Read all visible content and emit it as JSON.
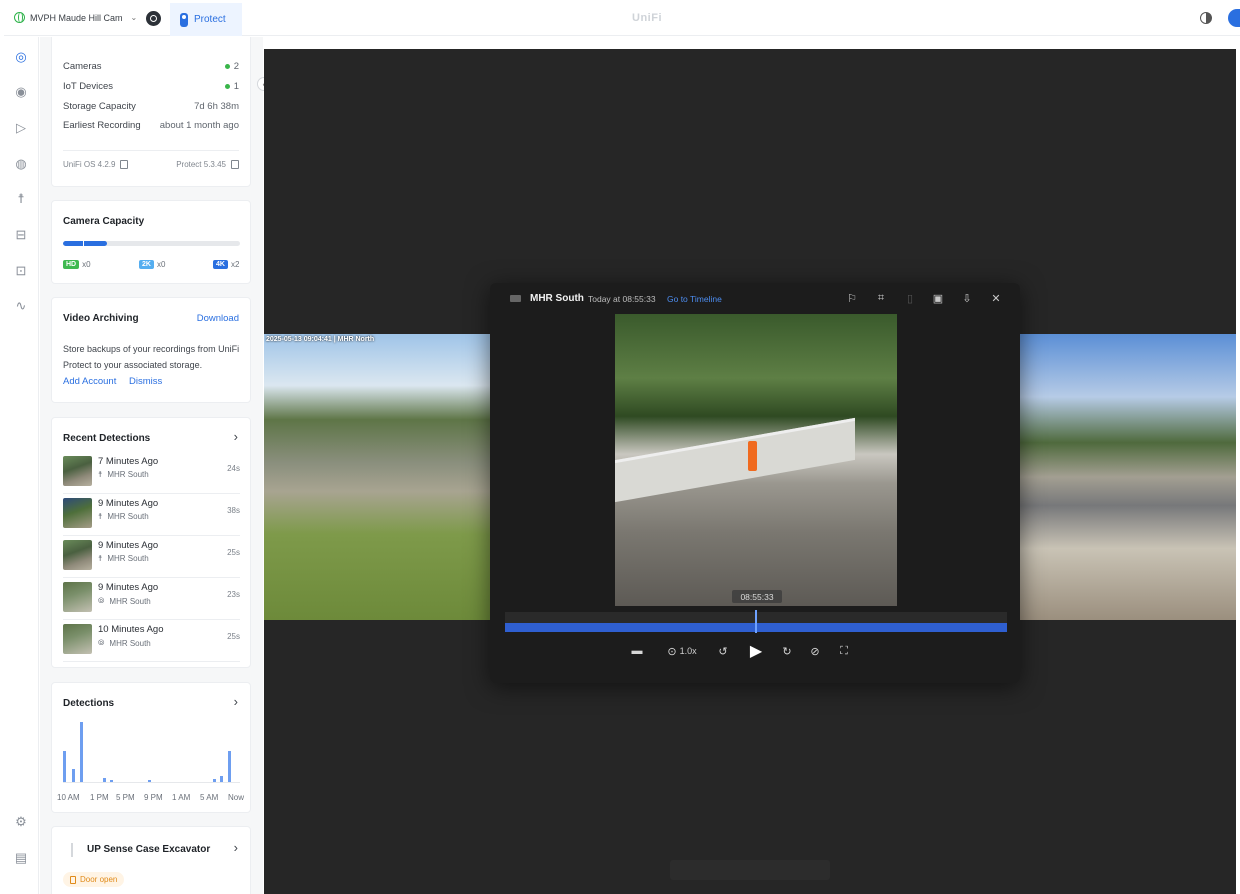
{
  "topbar": {
    "site_name": "MVPH Maude Hill Cam",
    "app_tab": "Protect",
    "brand": "UniFi"
  },
  "icons": {
    "left_nav": [
      "dashboard-icon",
      "camera-icon",
      "play-icon",
      "map-icon",
      "person-icon",
      "car-icon",
      "inbox-icon",
      "activity-icon",
      "settings-icon",
      "clipboard-icon"
    ]
  },
  "stats": {
    "rows": [
      {
        "label": "Cameras",
        "value": "2"
      },
      {
        "label": "IoT Devices",
        "value": "1"
      },
      {
        "label": "Storage Capacity",
        "value": "7d 6h 38m"
      },
      {
        "label": "Earliest Recording",
        "value": "about 1 month ago"
      }
    ],
    "os_version": "UniFi OS 4.2.9",
    "protect_version": "Protect 5.3.45"
  },
  "camera_capacity": {
    "title": "Camera Capacity",
    "fill_fraction": 0.25,
    "hd": {
      "tag": "HD",
      "count": "x0",
      "color": "#3fb950"
    },
    "k2": {
      "tag": "2K",
      "count": "x0",
      "color": "#55aef0"
    },
    "k4": {
      "tag": "4K",
      "count": "x2",
      "color": "#2a6fe0"
    }
  },
  "archiving": {
    "title": "Video Archiving",
    "download": "Download",
    "description": "Store backups of your recordings from UniFi Protect to your associated storage.",
    "add_account": "Add Account",
    "dismiss": "Dismiss"
  },
  "recent": {
    "title": "Recent Detections",
    "items": [
      {
        "time": "7 Minutes Ago",
        "camera": "MHR South",
        "duration": "24s",
        "type": "person"
      },
      {
        "time": "9 Minutes Ago",
        "camera": "MHR South",
        "duration": "38s",
        "type": "person"
      },
      {
        "time": "9 Minutes Ago",
        "camera": "MHR South",
        "duration": "25s",
        "type": "person"
      },
      {
        "time": "9 Minutes Ago",
        "camera": "MHR South",
        "duration": "23s",
        "type": "motion"
      },
      {
        "time": "10 Minutes Ago",
        "camera": "MHR South",
        "duration": "25s",
        "type": "motion"
      }
    ]
  },
  "detections": {
    "title": "Detections",
    "axis_labels": [
      "10 AM",
      "1 PM",
      "5 PM",
      "9 PM",
      "1 AM",
      "5 AM",
      "Now"
    ],
    "bars": [
      {
        "offset": 0.0,
        "level": 0.52
      },
      {
        "offset": 0.05,
        "level": 0.22
      },
      {
        "offset": 0.1,
        "level": 1.0
      },
      {
        "offset": 0.23,
        "level": 0.06
      },
      {
        "offset": 0.27,
        "level": 0.04
      },
      {
        "offset": 0.49,
        "level": 0.03
      },
      {
        "offset": 0.86,
        "level": 0.05
      },
      {
        "offset": 0.9,
        "level": 0.1
      },
      {
        "offset": 0.95,
        "level": 0.52
      }
    ]
  },
  "sensor": {
    "title": "UP Sense Case Excavator",
    "status": "Door open"
  },
  "viewer": {
    "left_camera_label": "2025-05-13 09:04:41 | MHR North",
    "camera": "MHR South",
    "time": "Today at 08:55:33",
    "go_to_timeline": "Go to Timeline",
    "timestamp": "08:55:33",
    "speed": "1.0x"
  }
}
